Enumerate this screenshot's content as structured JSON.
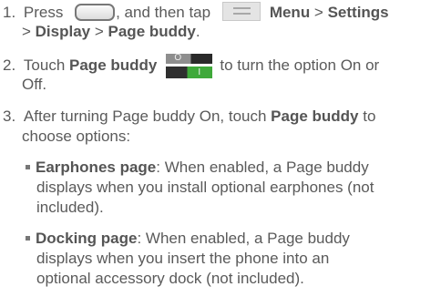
{
  "steps": [
    {
      "number": "1.",
      "line1_prefix": "Press ",
      "line1_mid": ", and then tap ",
      "menu_label": "Menu",
      "sep1": " > ",
      "settings_label": "Settings",
      "line2_sep_a": "> ",
      "display_label": "Display",
      "line2_sep_b": " > ",
      "page_buddy_label": "Page buddy",
      "end": "."
    },
    {
      "number": "2.",
      "touch": "Touch ",
      "page_buddy_label": "Page buddy",
      "rest": "to turn the option On or",
      "line2": "Off.",
      "toggle_off_symbol": "O",
      "toggle_on_symbol": "I"
    },
    {
      "number": "3.",
      "line1_prefix": "After turning Page buddy On, touch ",
      "page_buddy_label": "Page buddy",
      "line1_suffix": " to",
      "line2": "choose options:"
    }
  ],
  "options": [
    {
      "title": "Earphones page",
      "line1_rest": ": When enabled, a Page buddy",
      "line2": "displays when you install optional earphones (not",
      "line3": "included)."
    },
    {
      "title": "Docking page",
      "line1_rest": ": When enabled, a Page buddy",
      "line2": "displays when you insert the phone into an",
      "line3": "optional accessory dock (not included)."
    }
  ],
  "icons": {
    "home_button": "home-key-icon",
    "menu_button": "menu-key-icon",
    "toggle": "toggle-switch-icon"
  },
  "colors": {
    "text": "#5a5a5a",
    "toggle_on": "#3fa93a",
    "toggle_off": "#8e8e8e"
  }
}
